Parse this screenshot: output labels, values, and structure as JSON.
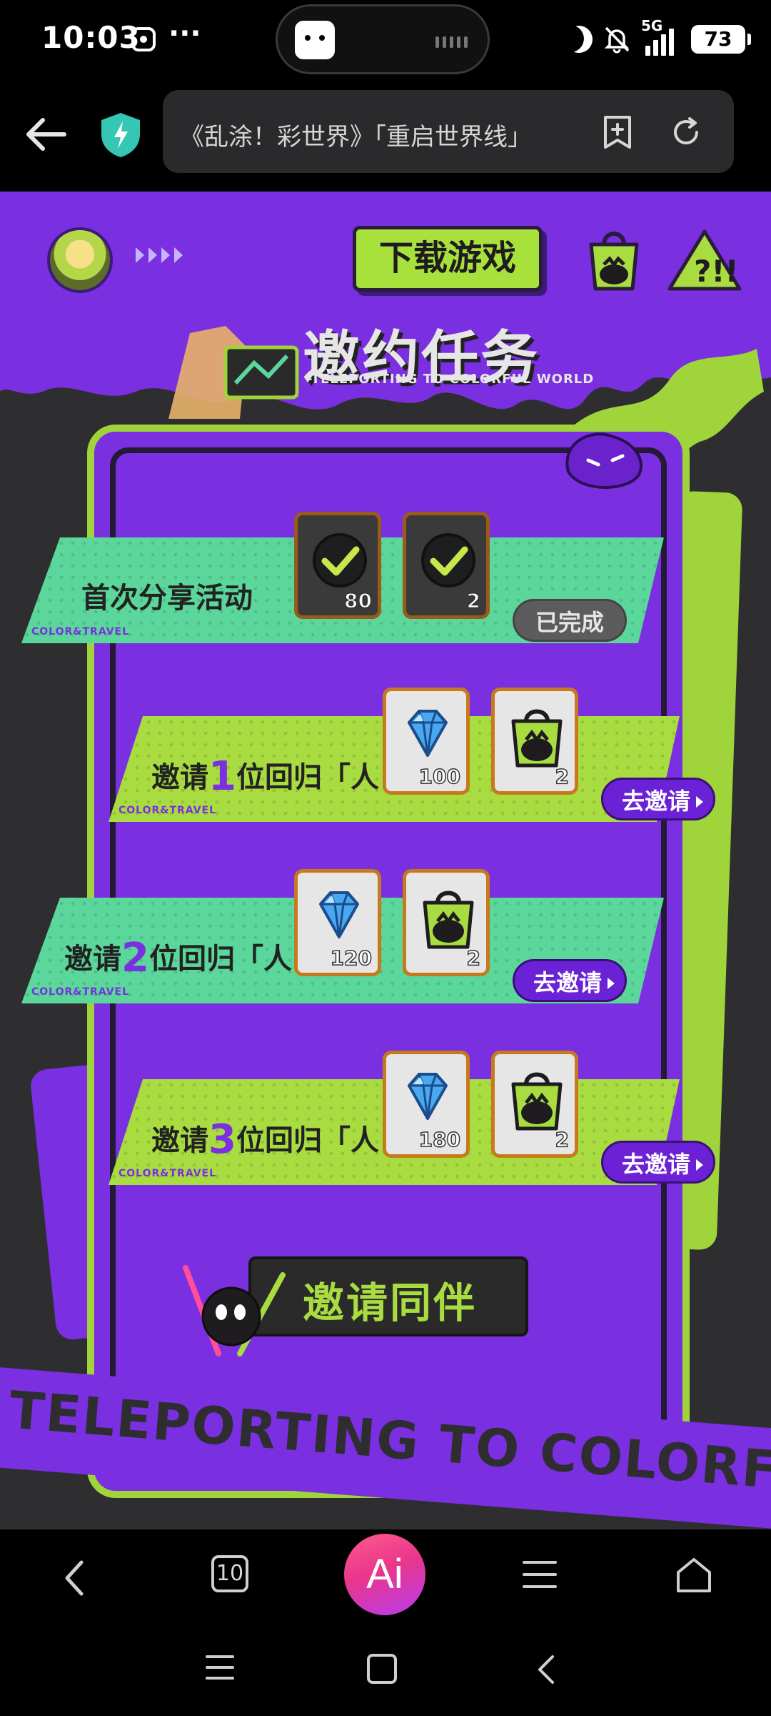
{
  "status_bar": {
    "time": "10:03",
    "more": "···",
    "network": "5G",
    "battery": "73"
  },
  "browser": {
    "url_title": "《乱涂！彩世界》「重启世界线」"
  },
  "page": {
    "download_button": "下载游戏",
    "section_title": "邀约任务",
    "section_subtitle": "-TELEPORTING TO COLORFUL WORLD",
    "brand_tag": "COLOR&TRAVEL",
    "tasks": [
      {
        "label": "首次分享活动",
        "rewards": [
          {
            "icon": "check-token",
            "count": "80"
          },
          {
            "icon": "check-token",
            "count": "2"
          }
        ],
        "button": "已完成",
        "status": "completed"
      },
      {
        "label_prefix": "邀请",
        "label_num": "1",
        "label_suffix": "位回归「人!」",
        "rewards": [
          {
            "icon": "diamond-gem",
            "count": "100"
          },
          {
            "icon": "paint-bag",
            "count": "2"
          }
        ],
        "button": "去邀请",
        "status": "open"
      },
      {
        "label_prefix": "邀请",
        "label_num": "2",
        "label_suffix": "位回归「人!」",
        "rewards": [
          {
            "icon": "diamond-gem",
            "count": "120"
          },
          {
            "icon": "paint-bag",
            "count": "2"
          }
        ],
        "button": "去邀请",
        "status": "open"
      },
      {
        "label_prefix": "邀请",
        "label_num": "3",
        "label_suffix": "位回归「人!」",
        "rewards": [
          {
            "icon": "diamond-gem",
            "count": "180"
          },
          {
            "icon": "paint-bag",
            "count": "2"
          }
        ],
        "button": "去邀请",
        "status": "open"
      }
    ],
    "invite_banner": "邀请同伴",
    "ribbon_text": "TELEPORTING TO COLORFUL WORLD"
  },
  "toolbar": {
    "tabs_count": "10",
    "ai_label": "Ai"
  },
  "colors": {
    "purple": "#7a2fe0",
    "lime": "#a8dc40",
    "mint": "#5bd79c",
    "dark": "#2e2e30"
  }
}
